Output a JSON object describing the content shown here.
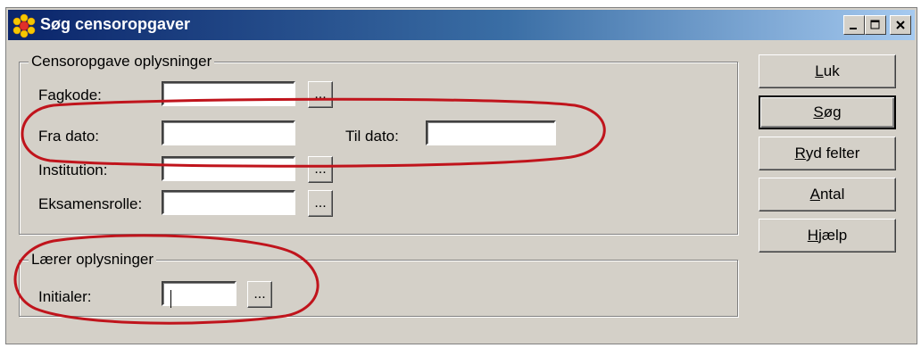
{
  "window": {
    "title": "Søg censoropgaver",
    "controls": [
      "_",
      "□",
      "×"
    ]
  },
  "group_censor": {
    "legend": "Censoropgave oplysninger",
    "fagkode": {
      "label": "Fagkode:",
      "value": ""
    },
    "fra_dato": {
      "label": "Fra dato:",
      "value": ""
    },
    "til_dato": {
      "label": "Til dato:",
      "value": ""
    },
    "institution": {
      "label": "Institution:",
      "value": ""
    },
    "eksamensrolle": {
      "label": "Eksamensrolle:",
      "value": ""
    },
    "lookup_label": "..."
  },
  "group_laerer": {
    "legend": "Lærer oplysninger",
    "initialer": {
      "label": "Initialer:",
      "value": ""
    },
    "lookup_label": "..."
  },
  "buttons": {
    "luk": {
      "first": "L",
      "rest": "uk"
    },
    "sog": {
      "first": "S",
      "rest": "øg"
    },
    "ryd": {
      "first": "R",
      "rest": "yd felter"
    },
    "antal": {
      "first": "A",
      "rest": "ntal"
    },
    "hjaelp": {
      "first": "H",
      "rest": "jælp"
    }
  },
  "colors": {
    "titlebar_start": "#0a246a",
    "dialog_face": "#d4d0c8",
    "annotation": "#c0141c"
  },
  "icons": {
    "app": "sun-flower-icon"
  }
}
